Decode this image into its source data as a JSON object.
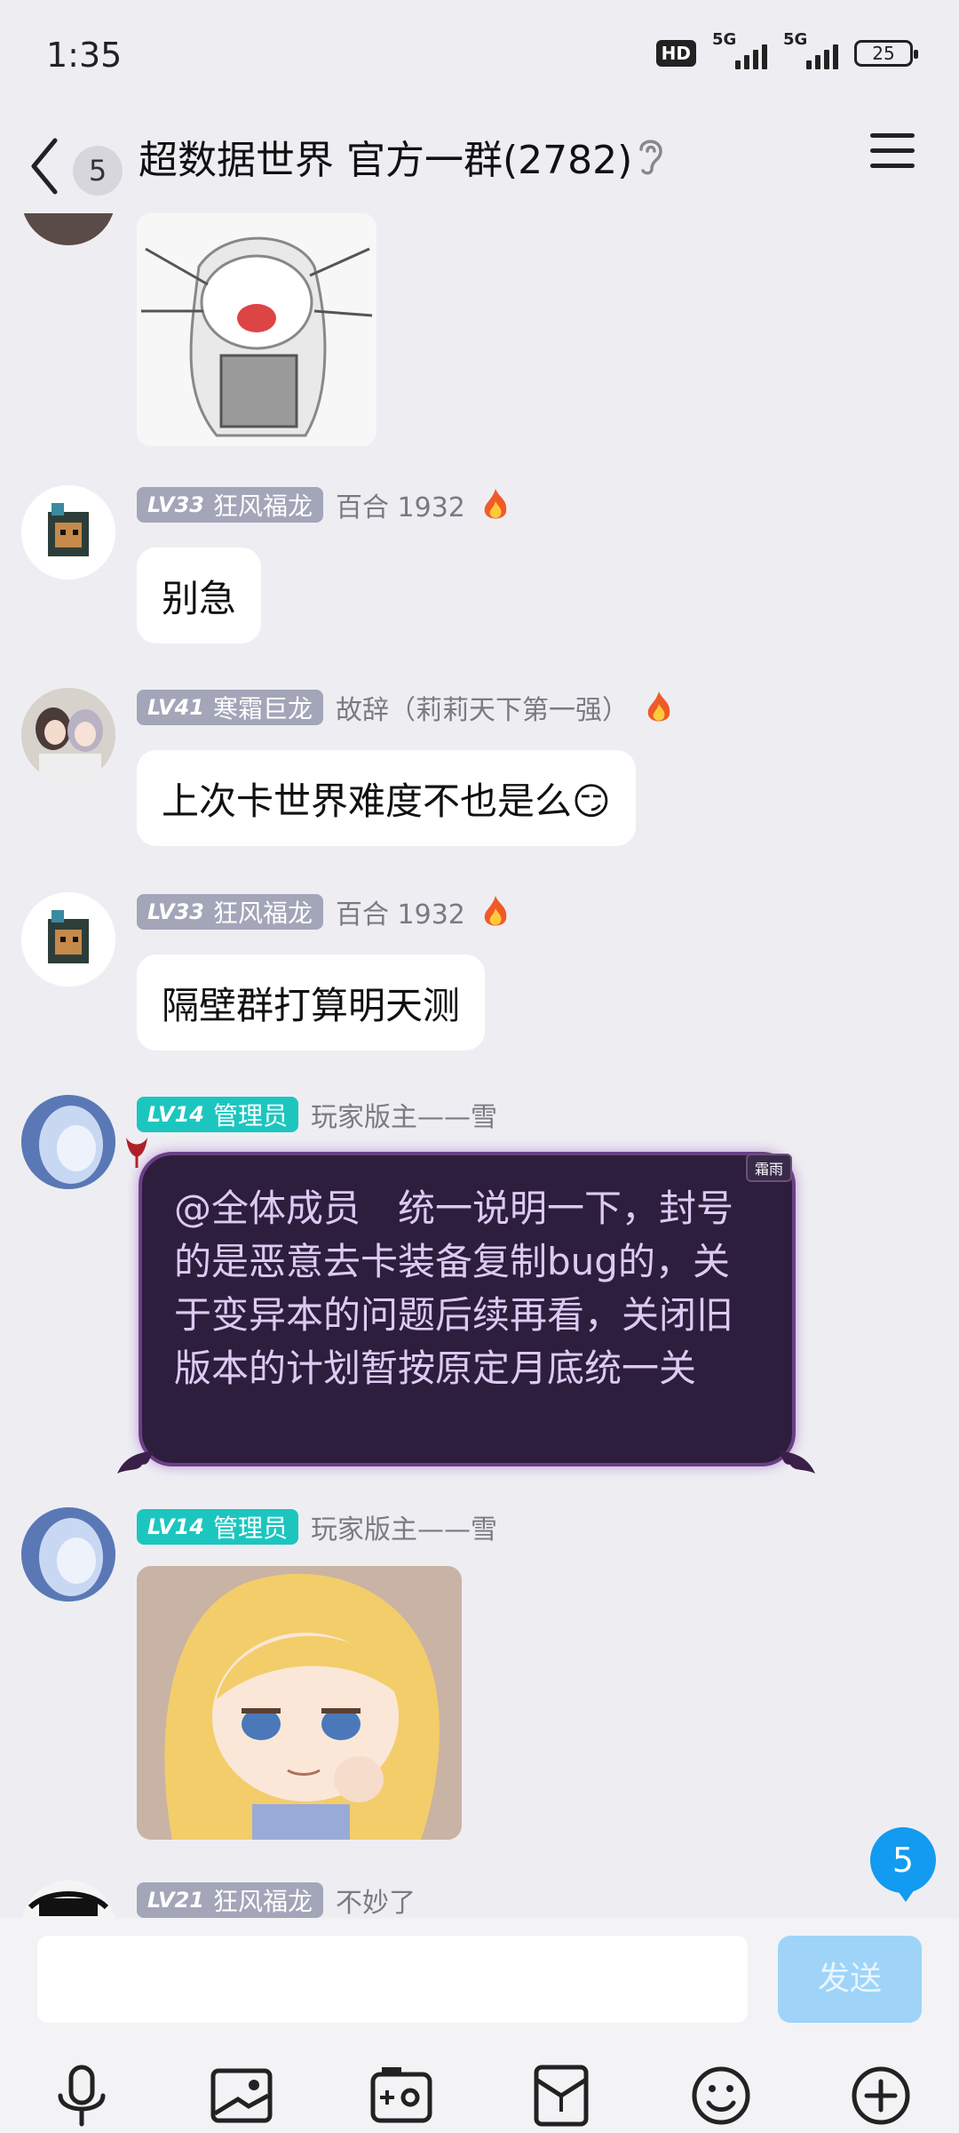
{
  "status": {
    "time": "1:35",
    "hd": "HD",
    "net1": "5G",
    "net2": "5G",
    "battery": "25"
  },
  "header": {
    "back_count": "5",
    "title": "超数据世界 官方一群(2782)"
  },
  "messages": [
    {
      "type": "image",
      "sender_level": "",
      "description": "sticker"
    },
    {
      "level": "LV33",
      "badge": "狂风福龙",
      "nick": "百合 1932",
      "text": "别急"
    },
    {
      "level": "LV41",
      "badge": "寒霜巨龙",
      "nick": "故辞（莉莉天下第一强）",
      "text": "上次卡世界难度不也是么😏"
    },
    {
      "level": "LV33",
      "badge": "狂风福龙",
      "nick": "百合 1932",
      "text": "隔壁群打算明天测"
    },
    {
      "level": "LV14",
      "badge": "管理员",
      "nick": "玩家版主——雪",
      "text": "@全体成员　统一说明一下，封号的是恶意去卡装备复制bug的，关于变异本的问题后续再看，关闭旧版本的计划暂按原定月底统一关",
      "bubble_tag": "霜雨"
    },
    {
      "level": "LV14",
      "badge": "管理员",
      "nick": "玩家版主——雪"
    },
    {
      "level": "LV21",
      "badge": "狂风福龙",
      "nick": "不妙了"
    }
  ],
  "new_messages_count": "5",
  "input": {
    "send_label": "发送",
    "placeholder": ""
  },
  "toolbar": [
    "mic-icon",
    "image-icon",
    "camera-icon",
    "red-packet-icon",
    "emoji-icon",
    "plus-icon"
  ],
  "colors": {
    "admin_badge": "#1cc6bf",
    "level_badge": "#a3a5b8",
    "send_button": "#9fd4f8",
    "badge_blue": "#129bf0"
  }
}
